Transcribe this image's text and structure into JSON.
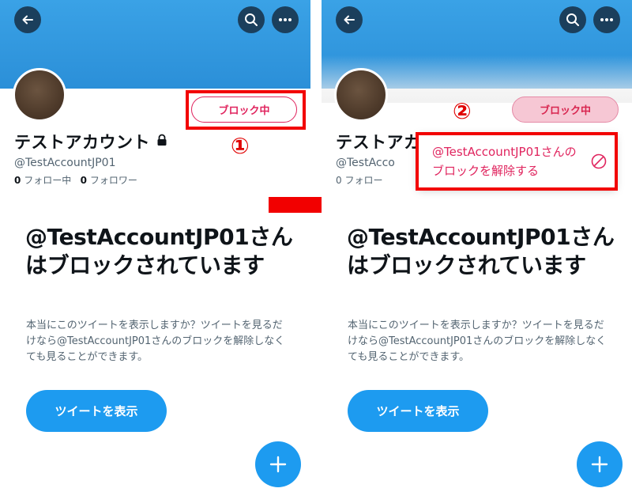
{
  "profile": {
    "display_name": "テストアカウント",
    "display_name_cut": "テストアカ",
    "handle": "@TestAccountJP01",
    "handle_cut": "@TestAcco",
    "following_count": "0",
    "following_label": "フォロー中",
    "followers_count": "0",
    "followers_label": "フォロワー",
    "following_cut": "0 フォロー"
  },
  "block_button_label": "ブロック中",
  "blocked_notice": {
    "headline": "@TestAccountJP01さんはブロックされています",
    "description": "本当にこのツイートを表示しますか？ツイートを見るだけなら@TestAccountJP01さんのブロックを解除しなくても見ることができます。",
    "show_tweets_label": "ツイートを表示"
  },
  "unblock_menu": {
    "label": "@TestAccountJP01さんのブロックを解除する"
  },
  "annotations": {
    "step1": "①",
    "step2": "②"
  },
  "colors": {
    "banner": "#2b8fd8",
    "primary": "#1d9bf0",
    "block_red": "#e0245e",
    "annotation_red": "#f20000"
  },
  "icons": [
    "back-arrow-icon",
    "search-icon",
    "more-icon",
    "lock-icon",
    "plus-icon",
    "unblock-icon",
    "arrow-right-icon"
  ]
}
